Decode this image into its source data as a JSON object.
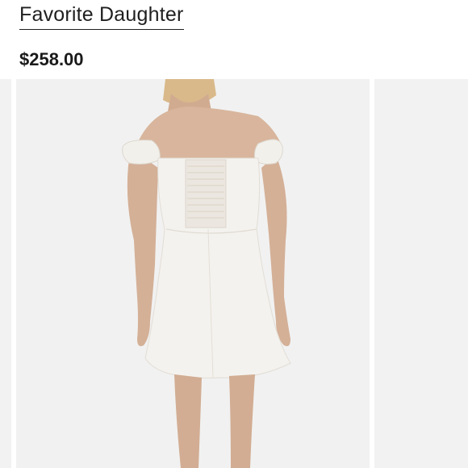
{
  "product": {
    "brand": "Favorite Daughter",
    "price": "$258.00"
  },
  "gallery": {
    "main_image_alt": "Back view of model wearing white off-the-shoulder mini dress with smocked back panel",
    "colors": {
      "background": "#f1f1f1",
      "dress": "#f3f1ec",
      "skin": "#d6b39a",
      "hair": "#d9b98a"
    }
  }
}
